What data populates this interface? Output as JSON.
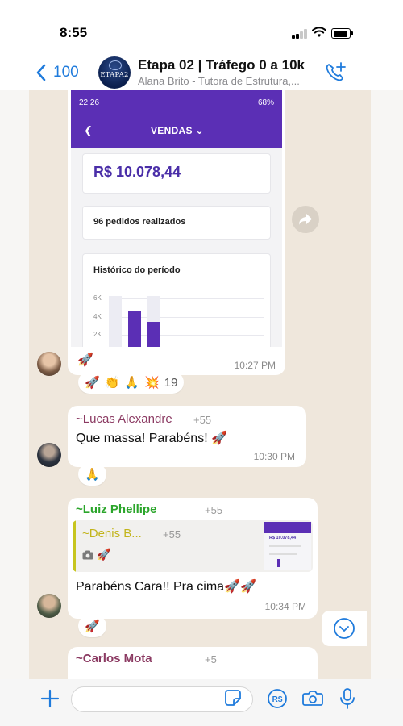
{
  "status_bar": {
    "time": "8:55"
  },
  "header": {
    "back_count": "100",
    "avatar_text": "ETAPA2",
    "title": "Etapa 02 | Tráfego 0 a 10k",
    "subtitle": "Alana Brito - Tutora de Estrutura,..."
  },
  "image_message": {
    "screenshot": {
      "status_time": "22:26",
      "status_battery": "68%",
      "nav_title": "VENDAS",
      "amount": "R$  10.078,44",
      "orders": "96 pedidos realizados",
      "history_title": "Histórico do período",
      "y_labels": [
        "6K",
        "4K",
        "2K"
      ],
      "bar_values": [
        0.0,
        0.7,
        0.5
      ]
    },
    "caption_emoji": "🚀",
    "time": "10:27 PM",
    "reactions": [
      "🚀",
      "👏",
      "🙏",
      "💥"
    ],
    "reaction_count": "19"
  },
  "messages": [
    {
      "sender": "~Lucas Alexandre",
      "sender_color": "#8b3a62",
      "phone": "+55",
      "text": "Que massa! Parabéns! 🚀",
      "time": "10:30 PM",
      "reactions": [
        "🙏"
      ]
    },
    {
      "sender": "~Luiz Phellipe",
      "sender_color": "#2aa52a",
      "phone": "+55 ",
      "quote": {
        "sender": "~Denis B...",
        "phone": "+55",
        "emoji": "🚀",
        "thumb_amount": "R$ 10.078,44"
      },
      "text": "Parabéns Cara!! Pra cima🚀🚀",
      "time": "10:34 PM",
      "reactions": [
        "🚀"
      ]
    },
    {
      "sender": "~Carlos Mota",
      "sender_color": "#8b3a62",
      "phone": "+5"
    }
  ],
  "colors": {
    "accent_blue": "#1f7bdc",
    "screenshot_purple": "#5b2fb5",
    "chat_background": "#efe7dc"
  },
  "icons": {
    "back": "chevron-left-icon",
    "call_add": "phone-plus-icon",
    "forward": "share-icon",
    "scroll": "chevron-down-circle-icon",
    "plus": "plus-icon",
    "sticker": "sticker-icon",
    "payment": "real-currency-icon",
    "camera": "camera-icon",
    "mic": "microphone-icon"
  }
}
